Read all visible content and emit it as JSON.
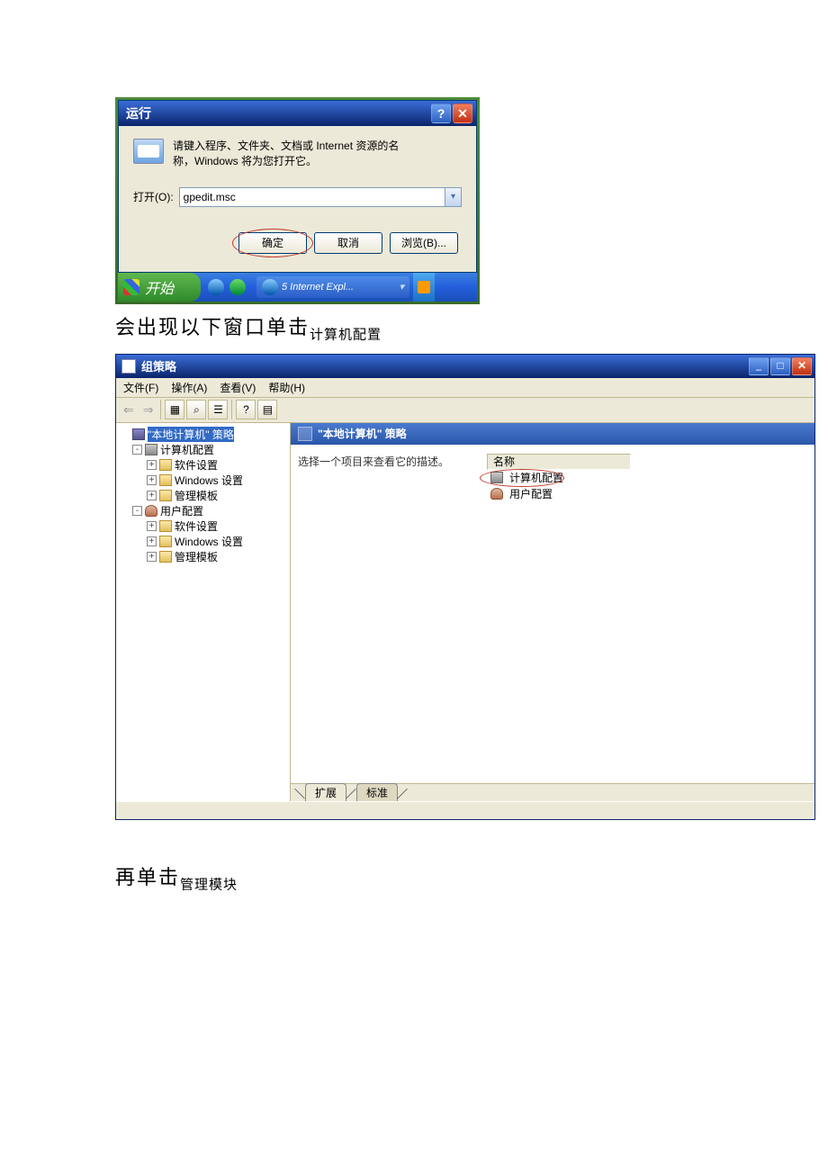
{
  "run": {
    "title": "运行",
    "prompt_line1": "请键入程序、文件夹、文档或 Internet 资源的名",
    "prompt_line2": "称，Windows 将为您打开它。",
    "open_label": "打开(O):",
    "input_value": "gpedit.msc",
    "ok": "确定",
    "cancel": "取消",
    "browse": "浏览(B)..."
  },
  "taskbar": {
    "start": "开始",
    "task1": "5 Internet Expl..."
  },
  "doc1_main": "会出现以下窗口单击",
  "doc1_sub": "计算机配置",
  "gp": {
    "title": "组策略",
    "menu": {
      "file": "文件(F)",
      "action": "操作(A)",
      "view": "查看(V)",
      "help": "帮助(H)"
    },
    "tree": {
      "root": "\"本地计算机\" 策略",
      "comp": "计算机配置",
      "soft": "软件设置",
      "win": "Windows 设置",
      "admin": "管理模板",
      "user": "用户配置"
    },
    "right": {
      "heading": "\"本地计算机\" 策略",
      "desc": "选择一个项目来查看它的描述。",
      "col_name": "名称",
      "item_comp": "计算机配置",
      "item_user": "用户配置",
      "tab_ext": "扩展",
      "tab_std": "标准"
    }
  },
  "doc2_main": "再单击",
  "doc2_sub": "管理模块"
}
